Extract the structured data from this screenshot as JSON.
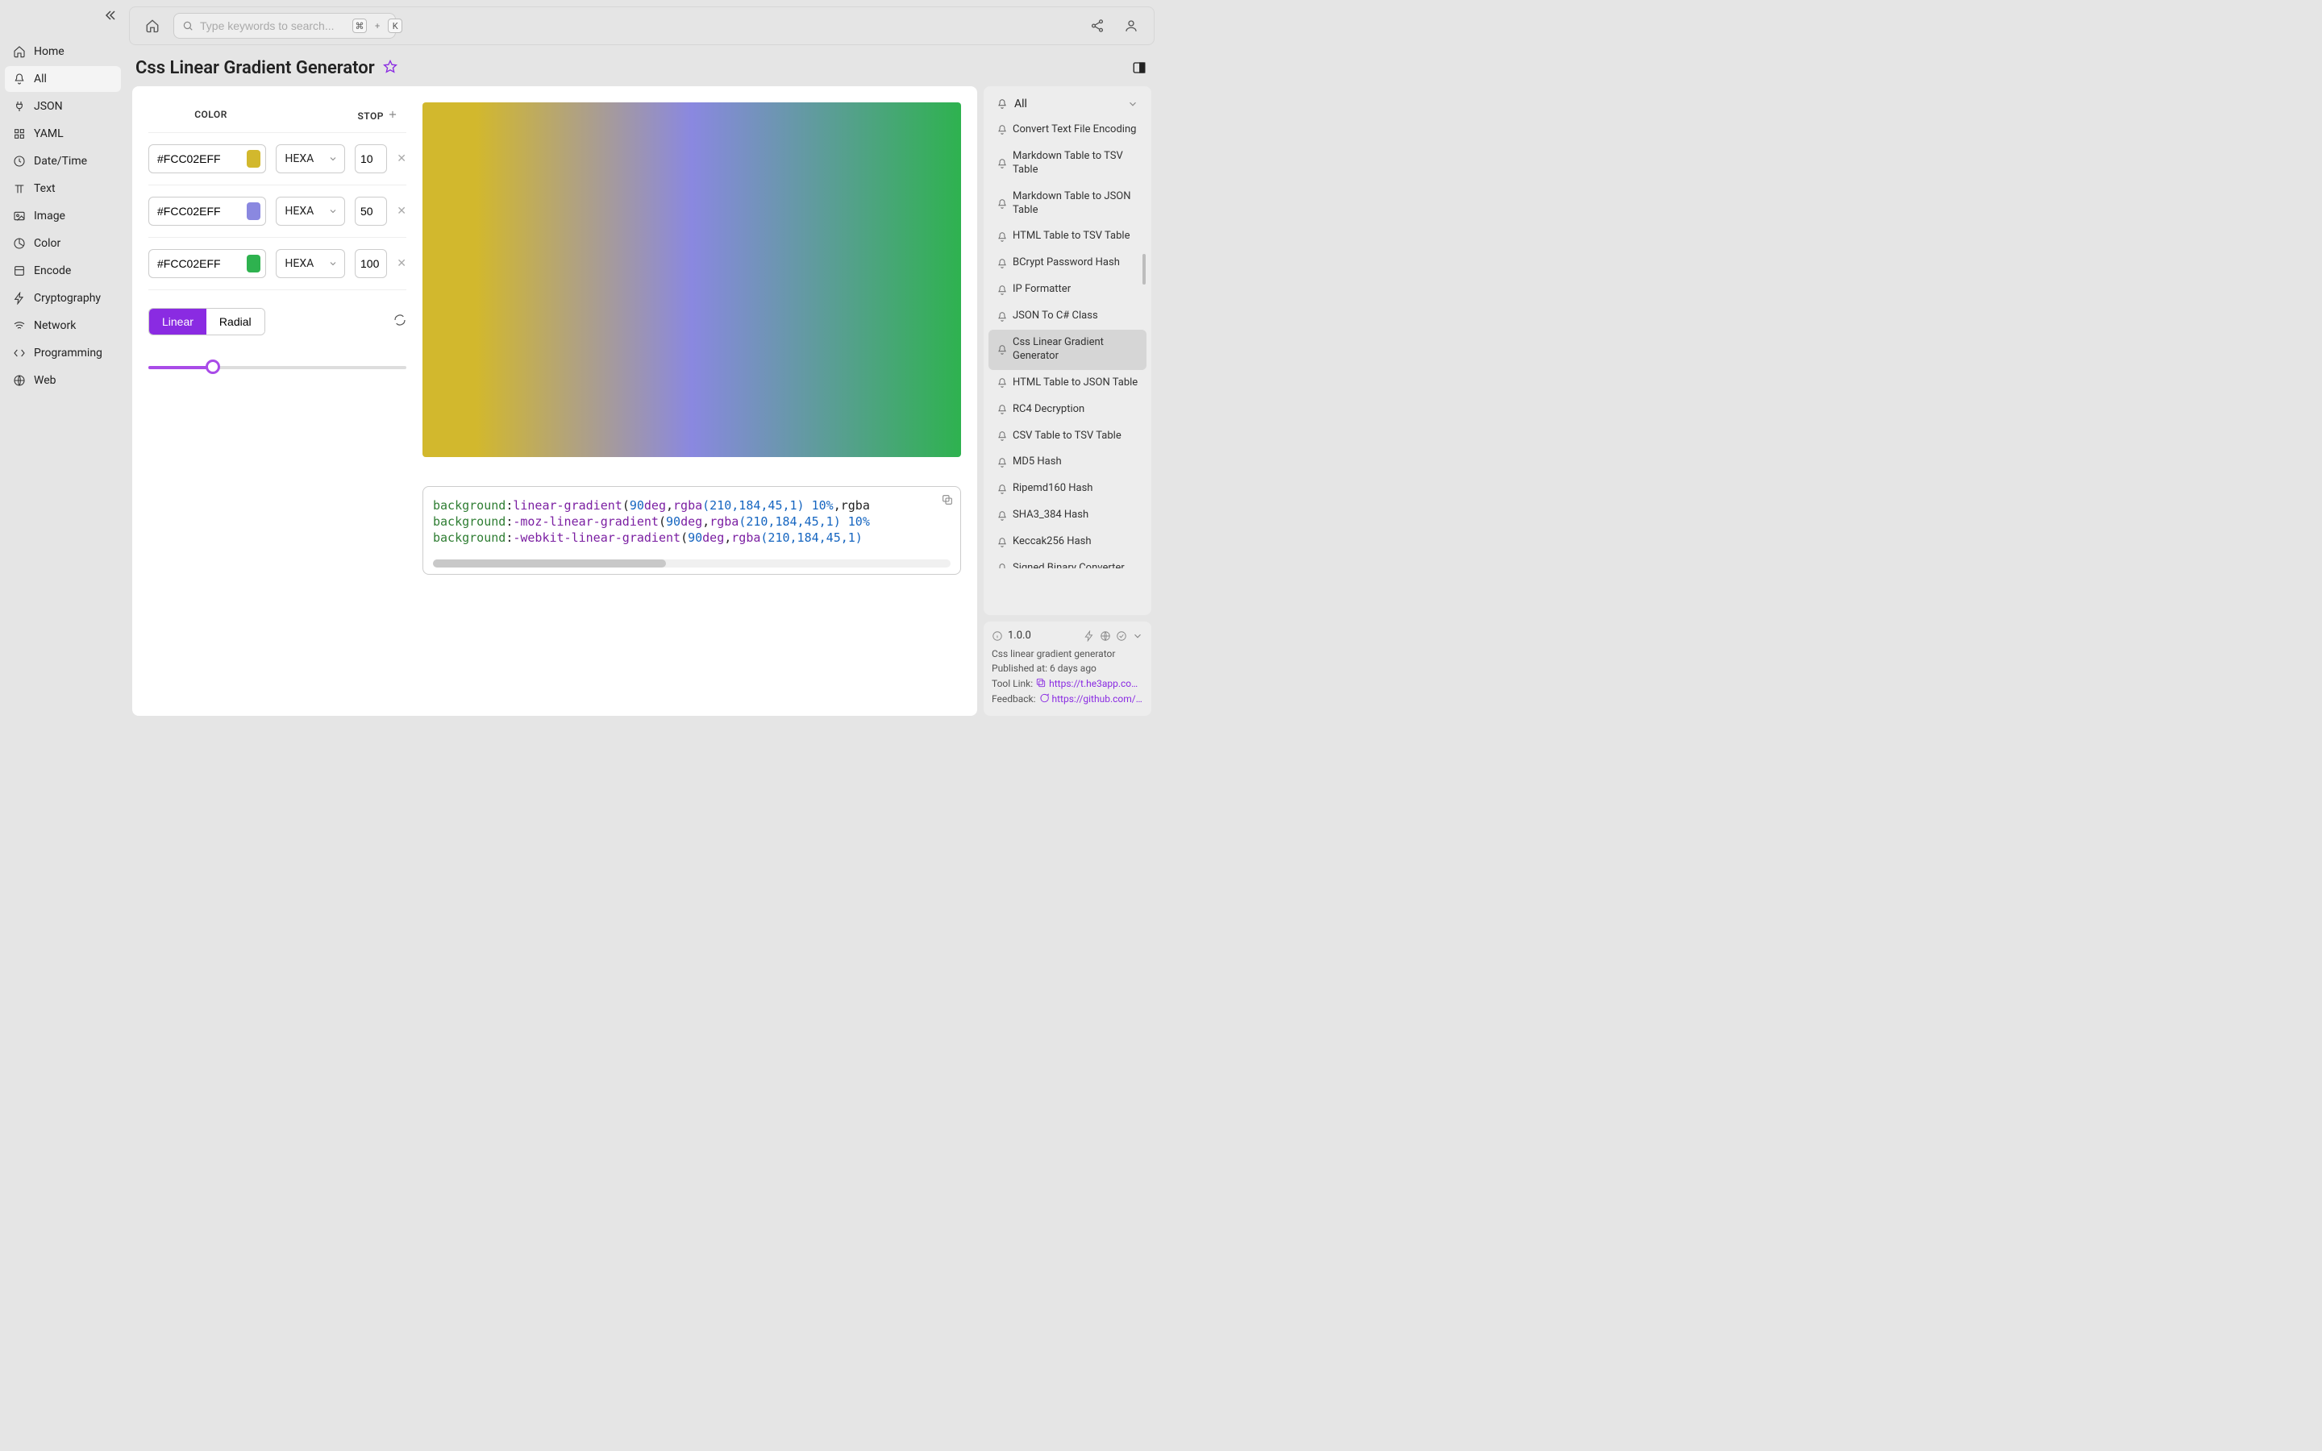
{
  "sidebar": {
    "items": [
      {
        "label": "Home",
        "icon": "home"
      },
      {
        "label": "All",
        "icon": "bell",
        "active": true
      },
      {
        "label": "JSON",
        "icon": "plug"
      },
      {
        "label": "YAML",
        "icon": "grid"
      },
      {
        "label": "Date/Time",
        "icon": "clock"
      },
      {
        "label": "Text",
        "icon": "type"
      },
      {
        "label": "Image",
        "icon": "image"
      },
      {
        "label": "Color",
        "icon": "pie"
      },
      {
        "label": "Encode",
        "icon": "box"
      },
      {
        "label": "Cryptography",
        "icon": "bolt"
      },
      {
        "label": "Network",
        "icon": "wifi"
      },
      {
        "label": "Programming",
        "icon": "code"
      },
      {
        "label": "Web",
        "icon": "globe"
      }
    ]
  },
  "search": {
    "placeholder": "Type keywords to search...",
    "kbd1": "⌘",
    "kbd_plus": "+",
    "kbd2": "K"
  },
  "page": {
    "title": "Css Linear Gradient Generator"
  },
  "controls": {
    "headers": {
      "color": "COLOR",
      "stop": "STOP"
    },
    "stops": [
      {
        "hex": "#FCC02EFF",
        "format": "HEXA",
        "stop": "10",
        "swatch": "#d2b82d"
      },
      {
        "hex": "#FCC02EFF",
        "format": "HEXA",
        "stop": "50",
        "swatch": "#8a88e0"
      },
      {
        "hex": "#FCC02EFF",
        "format": "HEXA",
        "stop": "100",
        "swatch": "#2eb24f"
      }
    ],
    "modes": {
      "linear": "Linear",
      "radial": "Radial"
    },
    "slider_percent": 25
  },
  "preview": {
    "gradient_css": "linear-gradient(90deg, rgba(210,184,45,1) 10%, rgba(138,136,224,1) 50%, rgba(46,178,79,1) 100%)"
  },
  "code": {
    "lines": [
      {
        "prop": "background",
        "func": "linear-gradient",
        "args_prefix": "(",
        "deg": "90",
        "deg_unit": "deg",
        "comma": ",",
        "rgba": "rgba",
        "nums": "(210,184,45,1)",
        "pct": " 10%",
        "tail": ",rgba"
      },
      {
        "prop": "background",
        "func": "-moz-linear-gradient",
        "args_prefix": "(",
        "deg": "90",
        "deg_unit": "deg",
        "comma": ",",
        "rgba": "rgba",
        "nums": "(210,184,45,1)",
        "pct": " 10%",
        "tail": ""
      },
      {
        "prop": "background",
        "func": "-webkit-linear-gradient",
        "args_prefix": "(",
        "deg": "90",
        "deg_unit": "deg",
        "comma": ",",
        "rgba": "rgba",
        "nums": "(210,184,45,1)",
        "pct": "",
        "tail": ""
      }
    ]
  },
  "right_panel": {
    "header_label": "All",
    "tools": [
      {
        "label": "Convert Text File Encoding"
      },
      {
        "label": "Markdown Table to TSV Table"
      },
      {
        "label": "Markdown Table to JSON Table"
      },
      {
        "label": "HTML Table to TSV Table"
      },
      {
        "label": "BCrypt Password Hash"
      },
      {
        "label": "IP Formatter"
      },
      {
        "label": "JSON To C# Class"
      },
      {
        "label": "Css Linear Gradient Generator",
        "active": true
      },
      {
        "label": "HTML Table to JSON Table"
      },
      {
        "label": "RC4 Decryption"
      },
      {
        "label": "CSV Table to TSV Table"
      },
      {
        "label": "MD5 Hash"
      },
      {
        "label": "Ripemd160 Hash"
      },
      {
        "label": "SHA3_384 Hash"
      },
      {
        "label": "Keccak256 Hash"
      },
      {
        "label": "Signed Binary Converter"
      }
    ]
  },
  "info": {
    "version": "1.0.0",
    "desc": "Css linear gradient generator",
    "published_label": "Published at:",
    "published_value": "6 days ago",
    "tool_link_label": "Tool Link:",
    "tool_link_value": "https://t.he3app.co…",
    "feedback_label": "Feedback:",
    "feedback_value": "https://github.com/…"
  }
}
